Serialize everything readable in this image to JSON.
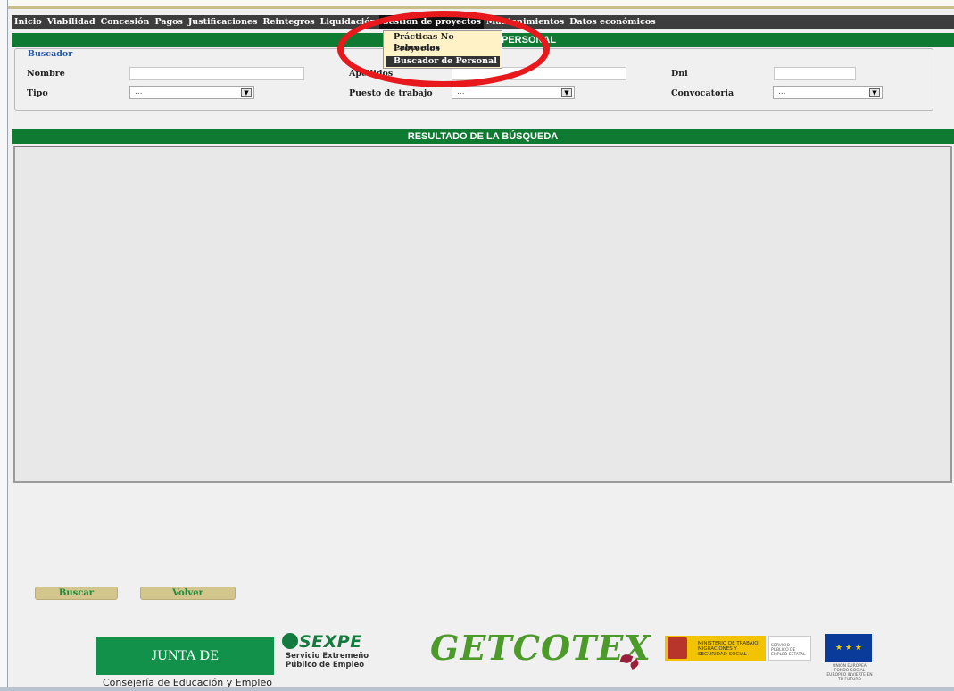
{
  "menu": {
    "items": [
      {
        "label": "Inicio"
      },
      {
        "label": "Viabilidad"
      },
      {
        "label": "Concesión"
      },
      {
        "label": "Pagos"
      },
      {
        "label": "Justificaciones"
      },
      {
        "label": "Reintegros"
      },
      {
        "label": "Liquidación"
      },
      {
        "label": "Gestión de proyectos"
      },
      {
        "label": "Mantenimientos"
      },
      {
        "label": "Datos económicos"
      }
    ],
    "active": "Gestión de proyectos",
    "dropdown": [
      "Prácticas No Laborales",
      "Proyectos",
      "Buscador de Personal"
    ],
    "dropdown_highlighted": "Buscador de Personal"
  },
  "header_title_visible": "PERSONAL",
  "search": {
    "legend": "Buscador",
    "nombre_label": "Nombre",
    "nombre_value": "",
    "apellidos_label": "Apellidos",
    "apellidos_value": "",
    "dni_label": "Dni",
    "dni_value": "",
    "tipo_label": "Tipo",
    "tipo_value": "...",
    "puesto_label": "Puesto de trabajo",
    "puesto_value": "...",
    "convocatoria_label": "Convocatoria",
    "convocatoria_value": "..."
  },
  "results": {
    "title": "RESULTADO DE LA BÚSQUEDA"
  },
  "buttons": {
    "buscar": "Buscar",
    "volver": "Volver"
  },
  "footer": {
    "junta": "JUNTA DE EXTREMADURA",
    "consejeria": "Consejería de Educación y Empleo",
    "sexpe": "SEXPE",
    "sexpe_sub1": "Servicio Extremeño",
    "sexpe_sub2": "Público de Empleo",
    "getcotex": "GETCOTEX",
    "ministerio": "MINISTERIO DE TRABAJO, MIGRACIONES Y SEGURIDAD SOCIAL",
    "sepe": "SERVICIO PÚBLICO DE EMPLEO ESTATAL",
    "eu_text": "UNIÓN EUROPEA FONDO SOCIAL EUROPEO INVIERTE EN TU FUTURO"
  },
  "colors": {
    "green_bar": "#0f7a32",
    "menu_bg": "#3d3d3d",
    "highlight_ring": "#e8191d",
    "button_bg": "#d2c68c"
  }
}
